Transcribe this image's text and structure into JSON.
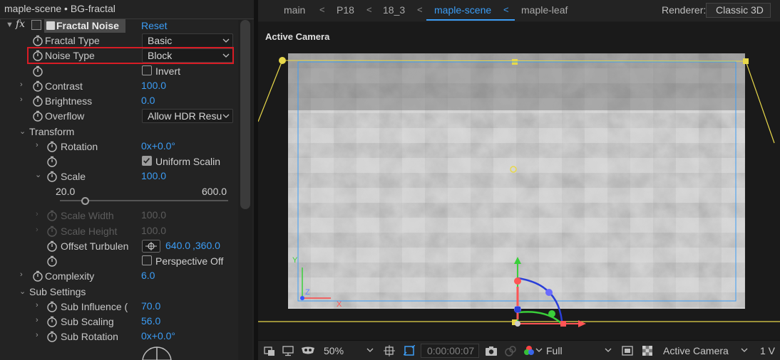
{
  "effect_panel": {
    "title": "maple-scene • BG-fractal",
    "effect_name": "Fractal Noise",
    "reset_label": "Reset",
    "fractal_type": {
      "label": "Fractal Type",
      "value": "Basic"
    },
    "noise_type": {
      "label": "Noise Type",
      "value": "Block"
    },
    "invert": {
      "label": "Invert",
      "checked": false
    },
    "contrast": {
      "label": "Contrast",
      "value": "100.0"
    },
    "brightness": {
      "label": "Brightness",
      "value": "0.0"
    },
    "overflow": {
      "label": "Overflow",
      "value": "Allow HDR Resu"
    },
    "transform": {
      "label": "Transform",
      "rotation": {
        "label": "Rotation",
        "value": "0x+0.0°"
      },
      "uniform_scaling": {
        "label": "Uniform Scalin",
        "checked": true
      },
      "scale": {
        "label": "Scale",
        "value": "100.0",
        "min": "20.0",
        "max": "600.0"
      },
      "scale_width": {
        "label": "Scale Width",
        "value": "100.0"
      },
      "scale_height": {
        "label": "Scale Height",
        "value": "100.0"
      },
      "offset_turbulence": {
        "label": "Offset Turbulen",
        "x": "640.0",
        "y": ",360.0"
      },
      "perspective_offset": {
        "label": "Perspective Off",
        "checked": false
      }
    },
    "complexity": {
      "label": "Complexity",
      "value": "6.0"
    },
    "sub_settings": {
      "label": "Sub Settings",
      "sub_influence": {
        "label": "Sub Influence (",
        "value": "70.0"
      },
      "sub_scaling": {
        "label": "Sub Scaling",
        "value": "56.0"
      },
      "sub_rotation": {
        "label": "Sub Rotation",
        "value": "0x+0.0°"
      }
    }
  },
  "composition_panel": {
    "tabs": [
      "main",
      "P18",
      "18_3",
      "maple-scene",
      "maple-leaf"
    ],
    "active_tab": "maple-scene",
    "renderer_label": "Renderer:",
    "renderer_value": "Classic 3D",
    "view_label": "Active Camera",
    "bottom_bar": {
      "zoom": "50%",
      "timecode": "0:00:00:07",
      "resolution": "Full",
      "camera": "Active Camera",
      "views": "1 V"
    },
    "colors": {
      "accent": "#3c9df5",
      "camera_lines": "#e8d84a",
      "highlight_box": "#d81c25"
    }
  }
}
